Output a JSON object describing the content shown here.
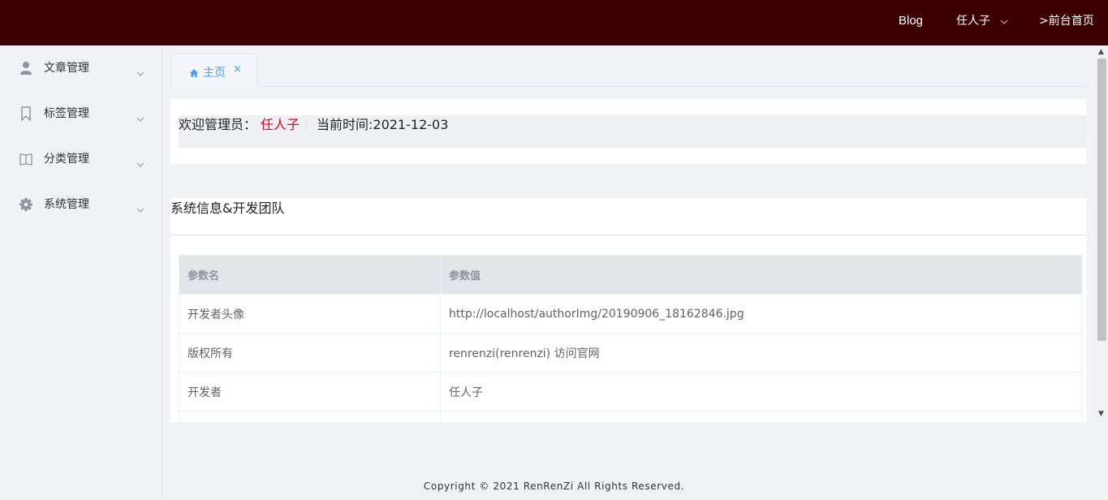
{
  "header": {
    "blog_label": "Blog",
    "user_label": "任人子",
    "front_label": ">前台首页",
    "bg_color": "#3c0000"
  },
  "sidebar": {
    "items": [
      {
        "label": "文章管理",
        "icon": "user-icon"
      },
      {
        "label": "标签管理",
        "icon": "bookmark-icon"
      },
      {
        "label": "分类管理",
        "icon": "book-icon"
      },
      {
        "label": "系统管理",
        "icon": "gear-icon"
      }
    ]
  },
  "tabs": [
    {
      "label": "主页",
      "icon": "home-icon",
      "close": "×"
    }
  ],
  "welcome": {
    "prefix": "欢迎管理员：",
    "name": "任人子",
    "time": "当前时间:2021-12-03",
    "name_color": "#e8001c"
  },
  "info": {
    "title": "系统信息&开发团队",
    "columns": [
      "参数名",
      "参数值"
    ],
    "rows": [
      [
        "开发者头像",
        "http://localhost/authorImg/20190906_18162846.jpg"
      ],
      [
        "版权所有",
        "renrenzi(renrenzi) 访问官网"
      ],
      [
        "开发者",
        "任人子"
      ],
      [
        "",
        ""
      ]
    ]
  },
  "footer": {
    "text": "Copyright © 2021 RenRenZi All Rights Reserved."
  },
  "accent_color": "#409eff"
}
